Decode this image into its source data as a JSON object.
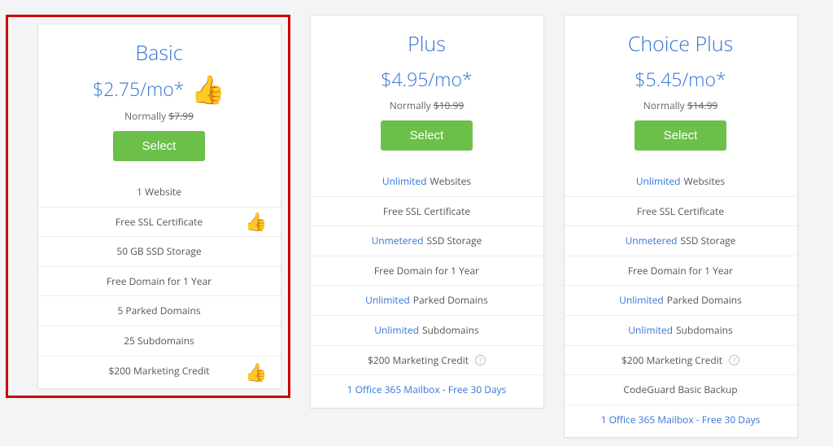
{
  "plans": [
    {
      "name": "Basic",
      "price": "$2.75/mo*",
      "normally_label": "Normally",
      "normally_price": "$7.99",
      "select_label": "Select",
      "thumb_on_price": true,
      "features": [
        {
          "text": "1 Website"
        },
        {
          "text": "Free SSL Certificate",
          "thumb": true
        },
        {
          "text": "50 GB SSD Storage"
        },
        {
          "text": "Free Domain for 1 Year"
        },
        {
          "text": "5 Parked Domains"
        },
        {
          "text": "25 Subdomains"
        },
        {
          "text": "$200 Marketing Credit",
          "thumb": true
        }
      ]
    },
    {
      "name": "Plus",
      "price": "$4.95/mo*",
      "normally_label": "Normally",
      "normally_price": "$10.99",
      "select_label": "Select",
      "features": [
        {
          "accent": "Unlimited",
          "text": "Websites"
        },
        {
          "text": "Free SSL Certificate"
        },
        {
          "accent": "Unmetered",
          "text": "SSD Storage"
        },
        {
          "text": "Free Domain for 1 Year"
        },
        {
          "accent": "Unlimited",
          "text": "Parked Domains"
        },
        {
          "accent": "Unlimited",
          "text": "Subdomains"
        },
        {
          "text": "$200 Marketing Credit",
          "info": true
        },
        {
          "accent": "1 Office 365 Mailbox - Free 30 Days"
        }
      ]
    },
    {
      "name": "Choice Plus",
      "price": "$5.45/mo*",
      "normally_label": "Normally",
      "normally_price": "$14.99",
      "select_label": "Select",
      "features": [
        {
          "accent": "Unlimited",
          "text": "Websites"
        },
        {
          "text": "Free SSL Certificate"
        },
        {
          "accent": "Unmetered",
          "text": "SSD Storage"
        },
        {
          "text": "Free Domain for 1 Year"
        },
        {
          "accent": "Unlimited",
          "text": "Parked Domains"
        },
        {
          "accent": "Unlimited",
          "text": "Subdomains"
        },
        {
          "text": "$200 Marketing Credit",
          "info": true
        },
        {
          "text": "CodeGuard Basic Backup"
        },
        {
          "accent": "1 Office 365 Mailbox - Free 30 Days"
        }
      ]
    }
  ]
}
